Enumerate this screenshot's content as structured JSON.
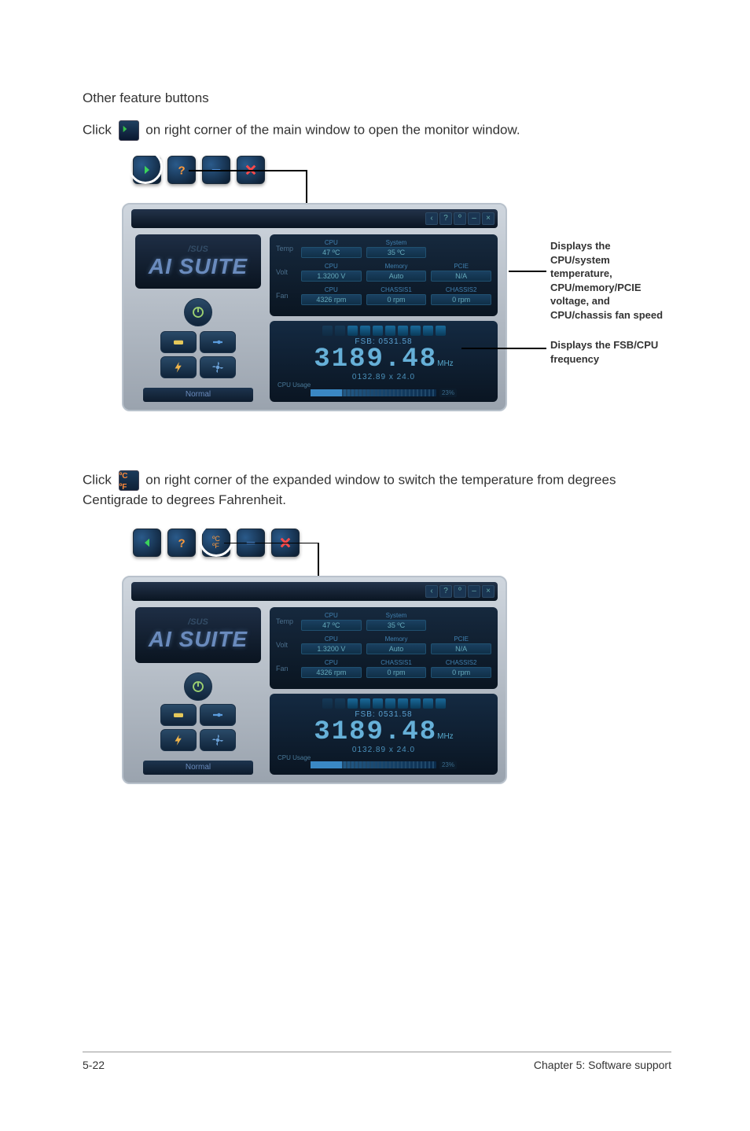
{
  "heading": "Other feature buttons",
  "para1": {
    "pre": "Click ",
    "post": " on right corner of the main window to open the monitor window."
  },
  "para2": {
    "pre": "Click ",
    "post": " on right corner of the expanded window to switch the temperature from degrees Centigrade to degrees Fahrenheit."
  },
  "callout1": "Displays the CPU/system temperature, CPU/memory/PCIE voltage, and CPU/chassis fan speed",
  "callout2": "Displays the FSB/CPU frequency",
  "panel": {
    "logo_brand": "/SUS",
    "logo_name": "AI SUITE",
    "profile": "Normal",
    "stats": {
      "temp": {
        "label": "Temp",
        "cols": [
          {
            "hdr": "CPU",
            "val": "47 ºC"
          },
          {
            "hdr": "System",
            "val": "35 ºC"
          }
        ]
      },
      "volt": {
        "label": "Volt",
        "cols": [
          {
            "hdr": "CPU",
            "val": "1.3200 V"
          },
          {
            "hdr": "Memory",
            "val": "Auto"
          },
          {
            "hdr": "PCIE",
            "val": "N/A"
          }
        ]
      },
      "fan": {
        "label": "Fan",
        "cols": [
          {
            "hdr": "CPU",
            "val": "4326 rpm"
          },
          {
            "hdr": "CHASSIS1",
            "val": "0 rpm"
          },
          {
            "hdr": "CHASSIS2",
            "val": "0 rpm"
          }
        ]
      }
    },
    "freq": {
      "fsb_label": "FSB: 0531.58",
      "cpu_freq": "3189.48",
      "mhz": "MHz",
      "multi": "0132.89  x  24.0",
      "usage_label": "CPU Usage",
      "usage_pct": "23%"
    }
  },
  "footer": {
    "left": "5-22",
    "right": "Chapter 5: Software support"
  }
}
